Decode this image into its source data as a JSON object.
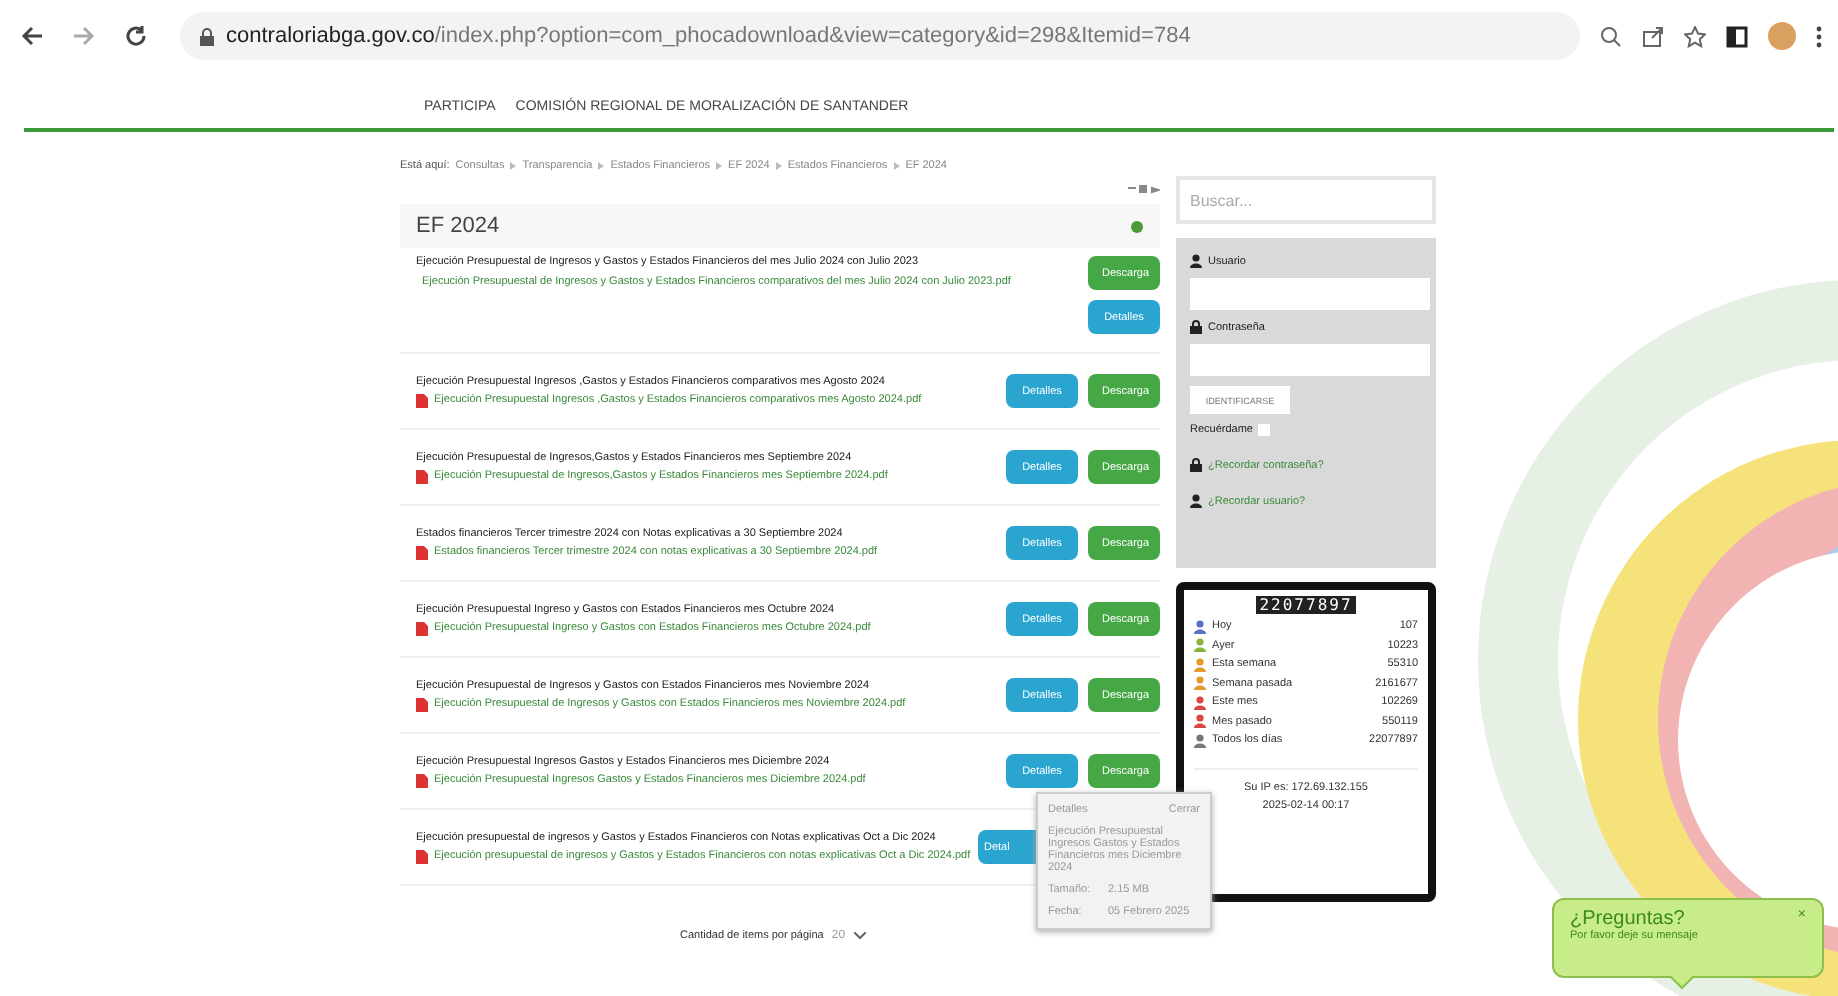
{
  "browser": {
    "url_host": "contraloriabga.gov.co",
    "url_path": "/index.php?option=com_phocadownload&view=category&id=298&Itemid=784"
  },
  "nav": [
    "PARTICIPA",
    "COMISIÓN REGIONAL DE MORALIZACIÓN DE SANTANDER"
  ],
  "breadcrumb": {
    "label": "Está aquí:",
    "items": [
      "Consultas",
      "Transparencia",
      "Estados Financieros",
      "EF 2024",
      "Estados Financieros",
      "EF 2024"
    ]
  },
  "category": {
    "title": "EF 2024"
  },
  "files": [
    {
      "title": "Ejecución Presupuestal de Ingresos y Gastos y Estados Financieros del mes Julio 2024 con Julio 2023",
      "file": "Ejecución Presupuestal de Ingresos y Gastos y Estados Financieros comparativos del mes Julio 2024 con Julio 2023.pdf",
      "kind": "stacked",
      "details": "Detalles",
      "download": "Descarga"
    },
    {
      "title": "Ejecución Presupuestal Ingresos ,Gastos y Estados Financieros comparativos mes Agosto 2024",
      "file": "Ejecución Presupuestal Ingresos ,Gastos y Estados Financieros comparativos mes Agosto 2024.pdf",
      "kind": "inline",
      "details": "Detalles",
      "download": "Descarga"
    },
    {
      "title": "Ejecución Presupuestal de Ingresos,Gastos y Estados Financieros mes Septiembre 2024",
      "file": "Ejecución Presupuestal de Ingresos,Gastos y Estados Financieros mes Septiembre 2024.pdf",
      "kind": "inline",
      "details": "Detalles",
      "download": "Descarga"
    },
    {
      "title": "Estados financieros Tercer trimestre 2024 con Notas explicativas a 30 Septiembre 2024",
      "file": "Estados financieros Tercer trimestre 2024 con notas explicativas a 30 Septiembre 2024.pdf",
      "kind": "inline",
      "details": "Detalles",
      "download": "Descarga"
    },
    {
      "title": "Ejecución Presupuestal Ingreso y Gastos con Estados Financieros mes Octubre 2024",
      "file": "Ejecución Presupuestal Ingreso y Gastos con Estados Financieros mes Octubre 2024.pdf",
      "kind": "inline",
      "details": "Detalles",
      "download": "Descarga"
    },
    {
      "title": "Ejecución Presupuestal de Ingresos y Gastos con Estados Financieros mes Noviembre 2024",
      "file": "Ejecución Presupuestal de Ingresos y Gastos con Estados Financieros mes Noviembre 2024.pdf",
      "kind": "inline",
      "details": "Detalles",
      "download": "Descarga"
    },
    {
      "title": "Ejecución Presupuestal Ingresos Gastos y Estados Financieros mes Diciembre 2024",
      "file": "Ejecución Presupuestal Ingresos Gastos y Estados Financieros mes Diciembre 2024.pdf",
      "kind": "inline",
      "details": "Detalles",
      "download": "Descarga"
    },
    {
      "title": "Ejecución presupuestal de ingresos y Gastos y Estados Financieros con Notas explicativas Oct a Dic 2024",
      "file": "Ejecución presupuestal de ingresos y Gastos y Estados Financieros con notas explicativas Oct a Dic 2024.pdf",
      "kind": "cut",
      "details": "Detal"
    }
  ],
  "tooltip": {
    "heading": "Detalles",
    "close": "Cerrar",
    "name": "Ejecución Presupuestal Ingresos Gastos y Estados Financieros mes Diciembre 2024",
    "size_label": "Tamaño:",
    "size": "2.15 MB",
    "date_label": "Fecha:",
    "date": "05 Febrero 2025"
  },
  "pagination": {
    "label": "Cantidad de items por página",
    "value": "20"
  },
  "search": {
    "placeholder": "Buscar..."
  },
  "login": {
    "user_label": "Usuario",
    "password_label": "Contraseña",
    "submit": "IDENTIFICARSE",
    "remember": "Recuérdame",
    "remember_checked": false,
    "links": [
      "¿Recordar contraseña?",
      "¿Recordar usuario?"
    ]
  },
  "counter": {
    "digits": "22077897",
    "rows": [
      {
        "label": "Hoy",
        "value": "107",
        "color": "#5b6fc4"
      },
      {
        "label": "Ayer",
        "value": "10223",
        "color": "#8cb23a"
      },
      {
        "label": "Esta semana",
        "value": "55310",
        "color": "#e39a2c"
      },
      {
        "label": "Semana pasada",
        "value": "2161677",
        "color": "#e39a2c"
      },
      {
        "label": "Este mes",
        "value": "102269",
        "color": "#d9473f"
      },
      {
        "label": "Mes pasado",
        "value": "550119",
        "color": "#d9473f"
      },
      {
        "label": "Todos los días",
        "value": "22077897",
        "color": "#777777"
      }
    ],
    "ip": "Su IP es: 172.69.132.155",
    "datetime": "2025-02-14 00:17"
  },
  "chat": {
    "title": "¿Preguntas?",
    "subtitle": "Por favor deje su mensaje",
    "close": "×"
  }
}
